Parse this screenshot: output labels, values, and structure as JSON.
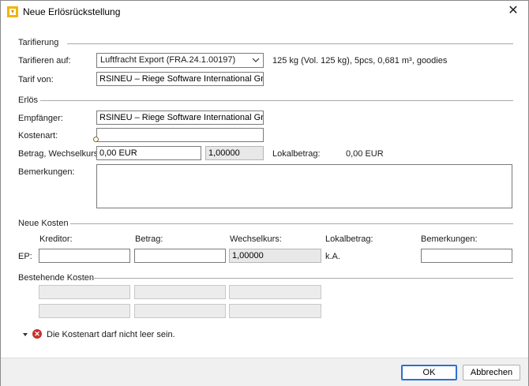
{
  "window": {
    "title": "Neue Erlösrückstellung",
    "close_glyph": "✕"
  },
  "tarifierung": {
    "section_label": "Tarifierung",
    "tarifieren_label": "Tarifieren auf:",
    "tarifieren_value": "Luftfracht Export (FRA.24.1.00197)",
    "shipment_info": "125 kg (Vol. 125 kg), 5pcs, 0,681 m³, goodies",
    "tarif_von_label": "Tarif von:",
    "tarif_von_value": "RSINEU – Riege Software International GmbH"
  },
  "erloes": {
    "section_label": "Erlös",
    "empfaenger_label": "Empfänger:",
    "empfaenger_value": "RSINEU – Riege Software International GmbH",
    "kostenart_label": "Kostenart:",
    "kostenart_value": "",
    "betrag_label": "Betrag, Wechselkurs:",
    "betrag_value": "0,00 EUR",
    "wechselkurs_value": "1,00000",
    "lokalbetrag_label": "Lokalbetrag:",
    "lokalbetrag_value": "0,00 EUR",
    "bemerkungen_label": "Bemerkungen:",
    "bemerkungen_value": ""
  },
  "neue_kosten": {
    "section_label": "Neue Kosten",
    "col_kreditor": "Kreditor:",
    "col_betrag": "Betrag:",
    "col_wechselkurs": "Wechselkurs:",
    "col_lokalbetrag": "Lokalbetrag:",
    "col_bemerkungen": "Bemerkungen:",
    "row_label": "EP:",
    "row_wechselkurs": "1,00000",
    "row_lokalbetrag": "k.A."
  },
  "bestehende_kosten": {
    "section_label": "Bestehende Kosten"
  },
  "validation": {
    "message": "Die Kostenart darf nicht leer sein."
  },
  "buttons": {
    "ok": "OK",
    "abbrechen": "Abbrechen"
  },
  "icons": {
    "title_icon": "app-logo-icon",
    "dropdown": "chevron-down-icon",
    "error": "error-icon",
    "expand": "expand-triangle-icon"
  },
  "colors": {
    "accent": "#2f6fd1",
    "error": "#c9302c",
    "readonly_bg": "#e8e8e8"
  }
}
